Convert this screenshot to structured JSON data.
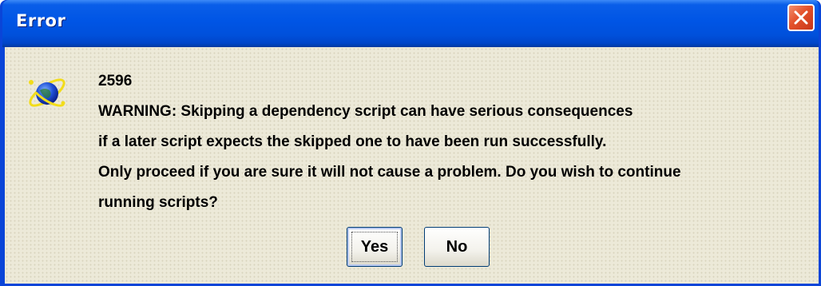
{
  "window": {
    "title": "Error",
    "close_icon": "close-icon",
    "accent_color": "#0055e5",
    "close_color": "#e3512b"
  },
  "dialog": {
    "icon": "globe-orbit-icon",
    "code": "2596",
    "message_lines": [
      "WARNING:  Skipping a dependency script can have serious consequences",
      "if a later script expects the skipped one to have been run successfully.",
      "Only proceed if you are sure it will not cause a problem.  Do you wish to continue",
      "running scripts?"
    ]
  },
  "buttons": {
    "yes_label": "Yes",
    "no_label": "No"
  }
}
